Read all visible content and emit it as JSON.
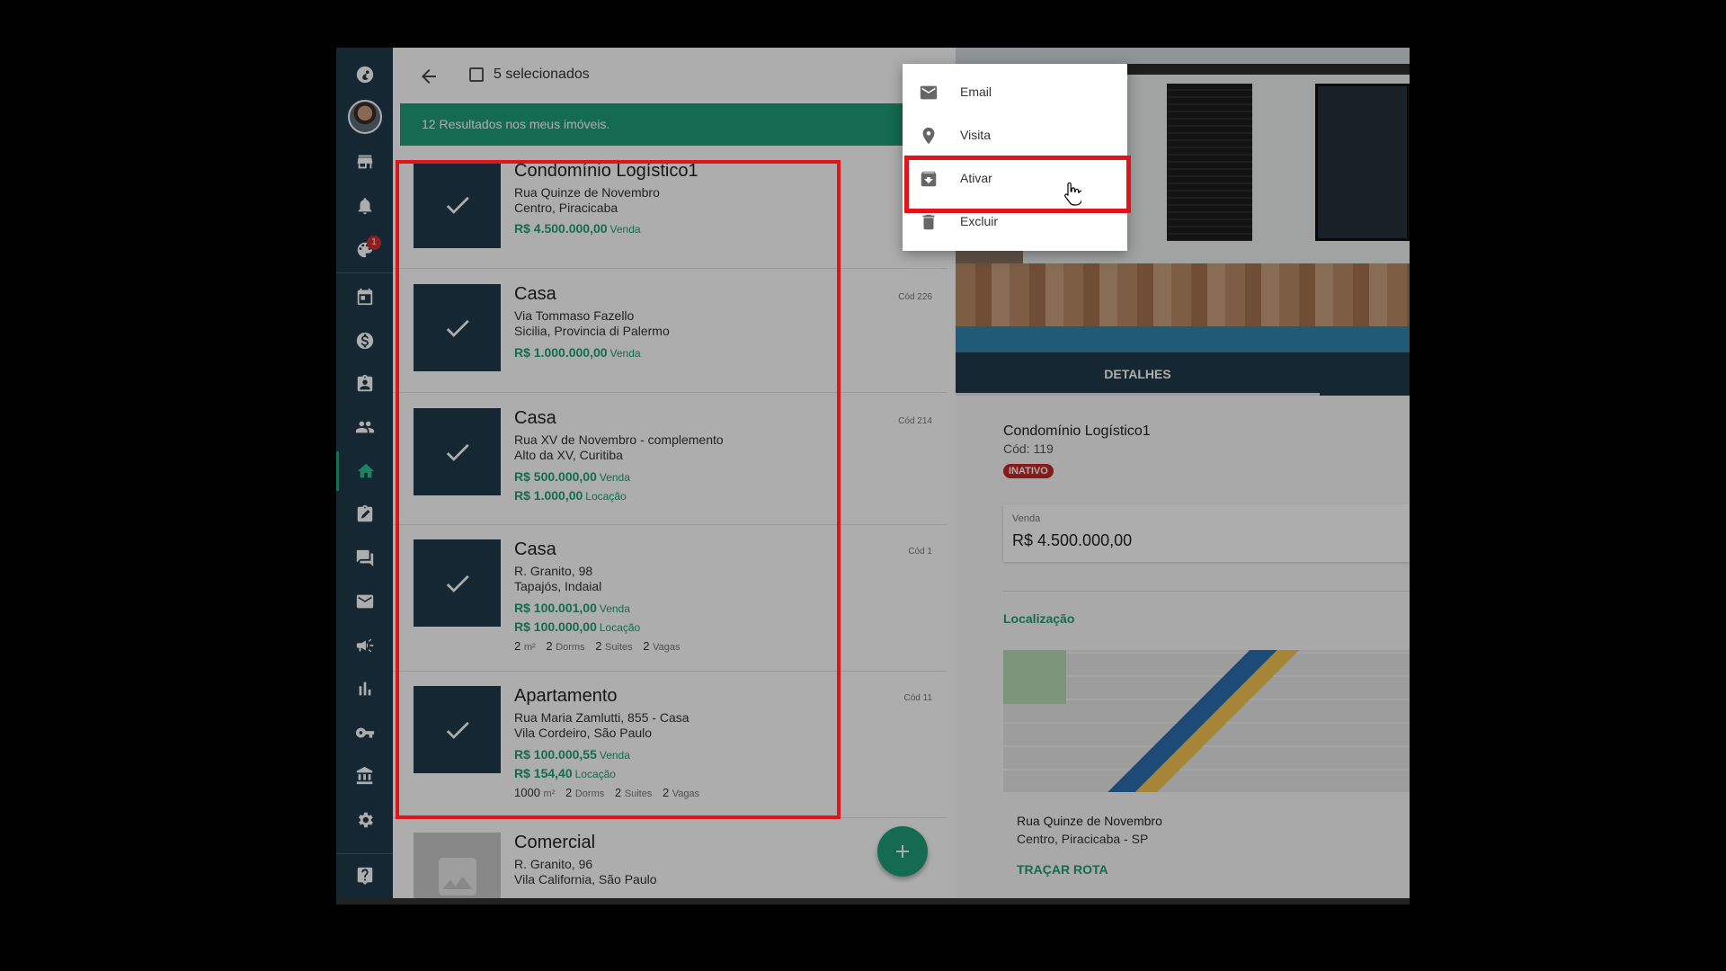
{
  "header": {
    "selected_count": "5 selecionados"
  },
  "results_bar": "12 Resultados nos meus imóveis.",
  "sidebar": {
    "notification_badge": "1",
    "items": [
      "logo-icon",
      "avatar",
      "store-icon",
      "bell-icon",
      "palette-icon",
      "calendar-icon",
      "dollar-icon",
      "badge-icon",
      "people-icon",
      "home-icon",
      "assignment-icon",
      "chat-icon",
      "mail-icon",
      "megaphone-icon",
      "chart-icon",
      "key-icon",
      "bank-icon",
      "gear-icon",
      "help-icon"
    ]
  },
  "properties": [
    {
      "title": "Condomínio Logístico1",
      "line1": "Rua Quinze de Novembro",
      "line2": "Centro, Piracicaba",
      "cod": "",
      "prices": [
        {
          "value": "R$ 4.500.000,00",
          "type": "Venda"
        }
      ],
      "features": null,
      "selected": true
    },
    {
      "title": "Casa",
      "line1": "Via Tommaso Fazello",
      "line2": "Sicilia, Provincia di Palermo",
      "cod": "Cód 226",
      "prices": [
        {
          "value": "R$ 1.000.000,00",
          "type": "Venda"
        }
      ],
      "features": null,
      "selected": true
    },
    {
      "title": "Casa",
      "line1": "Rua XV de Novembro - complemento",
      "line2": "Alto da XV, Curitiba",
      "cod": "Cód 214",
      "prices": [
        {
          "value": "R$ 500.000,00",
          "type": "Venda"
        },
        {
          "value": "R$ 1.000,00",
          "type": "Locação"
        }
      ],
      "features": null,
      "selected": true
    },
    {
      "title": "Casa",
      "line1": "R. Granito, 98",
      "line2": "Tapajós, Indaial",
      "cod": "Cód 1",
      "prices": [
        {
          "value": "R$ 100.001,00",
          "type": "Venda"
        },
        {
          "value": "R$ 100.000,00",
          "type": "Locação"
        }
      ],
      "features": {
        "area": "2",
        "area_unit": "m²",
        "dorms": "2",
        "dorms_label": "Dorms",
        "suites": "2",
        "suites_label": "Suites",
        "vagas": "2",
        "vagas_label": "Vagas"
      },
      "selected": true
    },
    {
      "title": "Apartamento",
      "line1": "Rua Maria Zamlutti, 855 - Casa",
      "line2": "Vila Cordeiro, São Paulo",
      "cod": "Cód 11",
      "prices": [
        {
          "value": "R$ 100.000,55",
          "type": "Venda"
        },
        {
          "value": "R$ 154,40",
          "type": "Locação"
        }
      ],
      "features": {
        "area": "1000",
        "area_unit": "m²",
        "dorms": "2",
        "dorms_label": "Dorms",
        "suites": "2",
        "suites_label": "Suites",
        "vagas": "2",
        "vagas_label": "Vagas"
      },
      "selected": true
    },
    {
      "title": "Comercial",
      "line1": "R. Granito, 96",
      "line2": "Vila California, São Paulo",
      "cod": "",
      "prices": [],
      "features": null,
      "selected": false
    }
  ],
  "context_menu": {
    "items": [
      {
        "label": "Email",
        "icon": "mail-icon"
      },
      {
        "label": "Visita",
        "icon": "location-pin-icon"
      },
      {
        "label": "Ativar",
        "icon": "archive-icon"
      },
      {
        "label": "Excluir",
        "icon": "trash-icon"
      }
    ]
  },
  "detail": {
    "tab_label": "DETALHES",
    "name": "Condomínio Logístico1",
    "cod": "Cód: 119",
    "status_badge": "INATIVO",
    "price_label": "Venda",
    "price_value": "R$ 4.500.000,00",
    "location_title": "Localização",
    "address_line1": "Rua Quinze de Novembro",
    "address_line2": "Centro, Piracicaba - SP",
    "route_label": "TRAÇAR ROTA"
  },
  "colors": {
    "sidebar": "#1f3a4b",
    "accent": "#1e9e75",
    "highlight": "#e0141b",
    "status_inactive": "#c62828"
  }
}
